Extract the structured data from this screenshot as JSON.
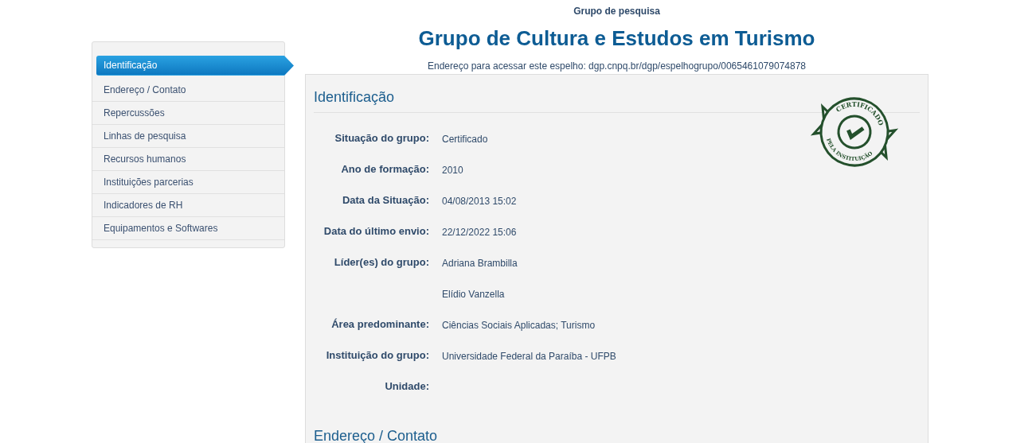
{
  "header": {
    "kicker": "Grupo de pesquisa",
    "title": "Grupo de Cultura e Estudos em Turismo",
    "address": "Endereço para acessar este espelho: dgp.cnpq.br/dgp/espelhogrupo/0065461079074878"
  },
  "sidebar": {
    "items": [
      {
        "label": "Identificação",
        "selected": true
      },
      {
        "label": "Endereço / Contato",
        "selected": false
      },
      {
        "label": "Repercussões",
        "selected": false
      },
      {
        "label": "Linhas de pesquisa",
        "selected": false
      },
      {
        "label": "Recursos humanos",
        "selected": false
      },
      {
        "label": "Instituições parcerias",
        "selected": false
      },
      {
        "label": "Indicadores de RH",
        "selected": false
      },
      {
        "label": "Equipamentos e Softwares",
        "selected": false
      }
    ]
  },
  "sections": [
    {
      "title": "Identificação",
      "stamp": {
        "top_text": "CERTIFICADO",
        "bottom_text": "PELA INSTITUIÇÃO"
      },
      "fields": [
        {
          "label": "Situação do grupo:",
          "values": [
            "Certificado"
          ]
        },
        {
          "label": "Ano de formação:",
          "values": [
            "2010"
          ]
        },
        {
          "label": "Data da Situação:",
          "values": [
            "04/08/2013 15:02"
          ]
        },
        {
          "label": "Data do último envio:",
          "values": [
            "22/12/2022 15:06"
          ]
        },
        {
          "label": "Líder(es) do grupo:",
          "values": [
            "Adriana Brambilla",
            "Elídio Vanzella"
          ]
        },
        {
          "label": "Área predominante:",
          "values": [
            "Ciências Sociais Aplicadas; Turismo"
          ]
        },
        {
          "label": "Instituição do grupo:",
          "values": [
            "Universidade Federal da Paraíba - UFPB"
          ]
        },
        {
          "label": "Unidade:"
        }
      ]
    },
    {
      "title": "Endereço / Contato"
    }
  ]
}
